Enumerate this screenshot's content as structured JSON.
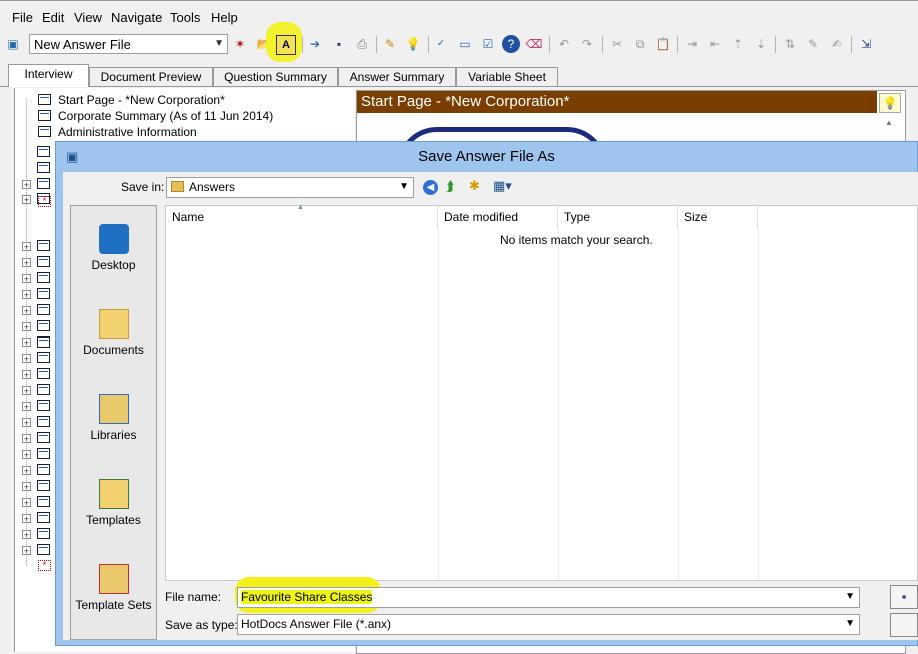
{
  "menu": [
    "File",
    "Edit",
    "View",
    "Navigate",
    "Tools",
    "Help"
  ],
  "toolbar": {
    "answer_file": "New Answer File"
  },
  "tabs": [
    "Interview",
    "Document Preview",
    "Question Summary",
    "Answer Summary",
    "Variable Sheet"
  ],
  "tree": {
    "items": [
      "Start Page - *New Corporation*",
      "Corporate Summary (As of 11 Jun 2014)",
      "Administrative Information"
    ]
  },
  "right_panel": {
    "title": "Start Page - *New Corporation*"
  },
  "dialog": {
    "title": "Save Answer File As",
    "save_in_label": "Save in:",
    "save_in_value": "Answers",
    "places": [
      "Desktop",
      "Documents",
      "Libraries",
      "Templates",
      "Template Sets"
    ],
    "columns": [
      "Name",
      "Date modified",
      "Type",
      "Size"
    ],
    "empty_message": "No items match your search.",
    "file_name_label": "File name:",
    "file_name_value": "Favourite Share Classes",
    "save_type_label": "Save as type:",
    "save_type_value": "HotDocs Answer File (*.anx)"
  },
  "colors": {
    "accent_highlight": "#ecf31a",
    "panel_title_bg": "#7a3f00",
    "dialog_frame": "#9ec5ee"
  }
}
